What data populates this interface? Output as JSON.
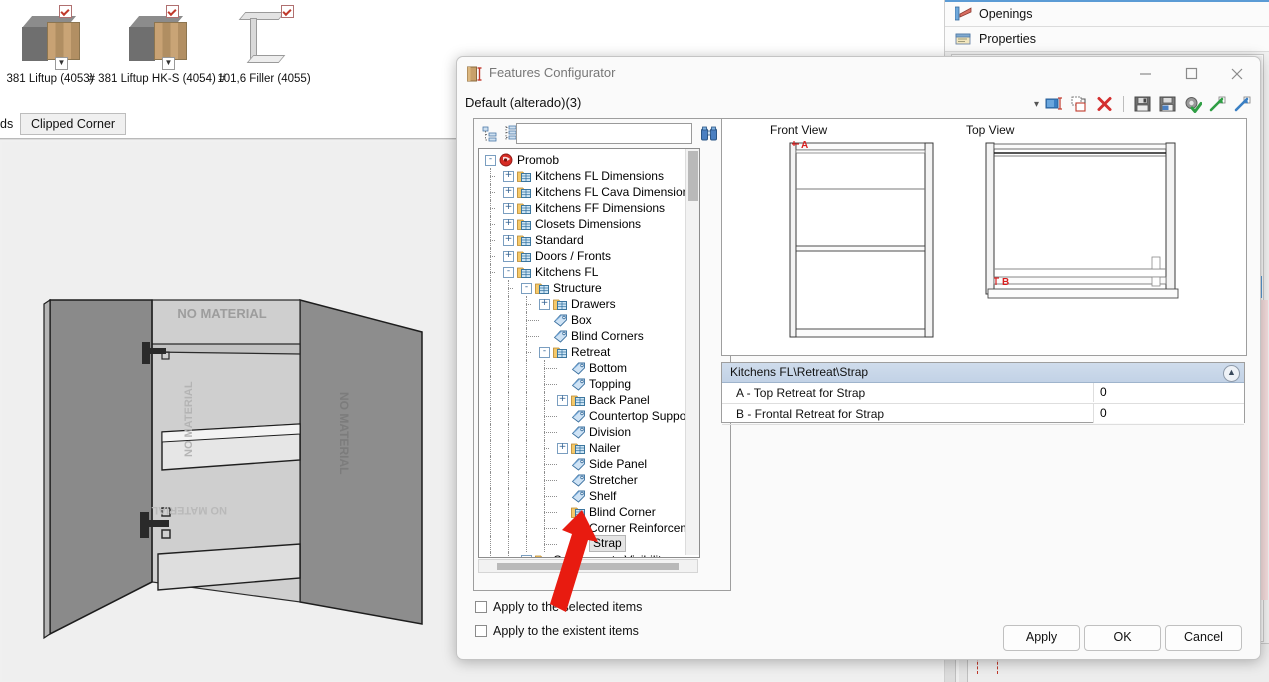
{
  "background": {
    "library": {
      "items": [
        {
          "label": "381 Liftup (4053)",
          "checked": true,
          "kind": "cabinet"
        },
        {
          "label": "# 381 Liftup HK-S (4054) #",
          "checked": true,
          "kind": "cabinet"
        },
        {
          "label": "101,6 Filler (4055)",
          "checked": true,
          "kind": "filler"
        }
      ]
    },
    "tabs": {
      "partial_left_label": "ds",
      "active_label": "Clipped Corner"
    },
    "viewport": {
      "material_watermark": "NO MATERIAL"
    },
    "dock": {
      "items": [
        {
          "label": "Openings",
          "icon": "openings-icon"
        },
        {
          "label": "Properties",
          "icon": "properties-icon"
        }
      ]
    }
  },
  "dialog": {
    "title": "Features Configurator",
    "title_icon": "features-configurator-icon",
    "subtitle": "Default (alterado)(3)",
    "window_buttons": {
      "minimize": "–",
      "maximize": "□",
      "close": "✕"
    },
    "toolbar": {
      "dropdown_label": "▾",
      "buttons": [
        {
          "name": "rename-icon",
          "tip": "Rename"
        },
        {
          "name": "duplicate-icon",
          "tip": "Duplicate"
        },
        {
          "name": "delete-icon",
          "tip": "Delete"
        },
        {
          "name": "save-icon",
          "tip": "Save"
        },
        {
          "name": "save-as-icon",
          "tip": "Save As"
        },
        {
          "name": "settings-apply-icon",
          "tip": "Apply Settings"
        },
        {
          "name": "import-icon",
          "tip": "Import"
        },
        {
          "name": "export-icon",
          "tip": "Export"
        }
      ]
    },
    "tree_toolbar": {
      "expand_all_icon": "expand-all-icon",
      "collapse_all_icon": "collapse-all-icon",
      "find_icon": "binoculars-find-icon",
      "search_value": "",
      "search_placeholder": ""
    },
    "tree": {
      "nodes": [
        {
          "label": "Promob",
          "depth": 0,
          "expander": "-",
          "icon": "promob-root-icon",
          "selected": false
        },
        {
          "label": "Kitchens FL Dimensions",
          "depth": 1,
          "expander": "+",
          "icon": "folder-table-icon",
          "selected": false
        },
        {
          "label": "Kitchens FL Cava Dimensions",
          "depth": 1,
          "expander": "+",
          "icon": "folder-table-icon",
          "selected": false
        },
        {
          "label": "Kitchens FF Dimensions",
          "depth": 1,
          "expander": "+",
          "icon": "folder-table-icon",
          "selected": false
        },
        {
          "label": "Closets Dimensions",
          "depth": 1,
          "expander": "+",
          "icon": "folder-table-icon",
          "selected": false
        },
        {
          "label": "Standard",
          "depth": 1,
          "expander": "+",
          "icon": "folder-table-icon",
          "selected": false
        },
        {
          "label": "Doors / Fronts",
          "depth": 1,
          "expander": "+",
          "icon": "folder-table-icon",
          "selected": false
        },
        {
          "label": "Kitchens FL",
          "depth": 1,
          "expander": "-",
          "icon": "folder-table-icon",
          "selected": false
        },
        {
          "label": "Structure",
          "depth": 2,
          "expander": "-",
          "icon": "folder-table-icon",
          "selected": false
        },
        {
          "label": "Drawers",
          "depth": 3,
          "expander": "+",
          "icon": "folder-table-icon",
          "selected": false
        },
        {
          "label": "Box",
          "depth": 3,
          "expander": "",
          "icon": "tag-icon",
          "selected": false
        },
        {
          "label": "Blind Corners",
          "depth": 3,
          "expander": "",
          "icon": "tag-icon",
          "selected": false
        },
        {
          "label": "Retreat",
          "depth": 3,
          "expander": "-",
          "icon": "folder-table-icon",
          "selected": false
        },
        {
          "label": "Bottom",
          "depth": 4,
          "expander": "",
          "icon": "tag-icon",
          "selected": false
        },
        {
          "label": "Topping",
          "depth": 4,
          "expander": "",
          "icon": "tag-icon",
          "selected": false
        },
        {
          "label": "Back Panel",
          "depth": 4,
          "expander": "+",
          "icon": "folder-table-icon",
          "selected": false
        },
        {
          "label": "Countertop Support",
          "depth": 4,
          "expander": "",
          "icon": "tag-icon",
          "selected": false
        },
        {
          "label": "Division",
          "depth": 4,
          "expander": "",
          "icon": "tag-icon",
          "selected": false
        },
        {
          "label": "Nailer",
          "depth": 4,
          "expander": "+",
          "icon": "folder-table-icon",
          "selected": false
        },
        {
          "label": "Side Panel",
          "depth": 4,
          "expander": "",
          "icon": "tag-icon",
          "selected": false
        },
        {
          "label": "Stretcher",
          "depth": 4,
          "expander": "",
          "icon": "tag-icon",
          "selected": false
        },
        {
          "label": "Shelf",
          "depth": 4,
          "expander": "",
          "icon": "tag-icon",
          "selected": false
        },
        {
          "label": "Blind Corner",
          "depth": 4,
          "expander": "",
          "icon": "folder-table-icon",
          "selected": false
        },
        {
          "label": "Corner Reinforcement",
          "depth": 4,
          "expander": "",
          "icon": "tag-icon",
          "selected": false
        },
        {
          "label": "Strap",
          "depth": 4,
          "expander": "",
          "icon": "tag-icon",
          "selected": true
        },
        {
          "label": "Components Visibility",
          "depth": 2,
          "expander": "-",
          "icon": "folder-table-icon",
          "selected": false
        }
      ]
    },
    "views": {
      "front_view_label": "Front View",
      "top_view_label": "Top View",
      "front_marker": "A",
      "top_marker": "B"
    },
    "properties": {
      "header": "Kitchens FL\\Retreat\\Strap",
      "collapse_icon": "chevron-up-double-icon",
      "rows": [
        {
          "name": "A - Top Retreat for Strap",
          "value": "0"
        },
        {
          "name": "B - Frontal Retreat for Strap",
          "value": "0"
        }
      ]
    },
    "checkboxes": [
      {
        "label": "Apply to the selected items",
        "checked": false
      },
      {
        "label": "Apply to the existent items",
        "checked": false
      }
    ],
    "buttons": [
      {
        "label": "Apply",
        "name": "apply-button"
      },
      {
        "label": "OK",
        "name": "ok-button"
      },
      {
        "label": "Cancel",
        "name": "cancel-button"
      }
    ]
  },
  "annotation": {
    "arrow_color": "#e81b10",
    "points_to": "Strap"
  },
  "colors": {
    "accent_blue": "#5b9bd5",
    "prop_header": "#c7d6e8",
    "selection_gray": "#e4e4e4",
    "dialog_bg": "#fafafa",
    "arrow_red": "#e81b10"
  }
}
